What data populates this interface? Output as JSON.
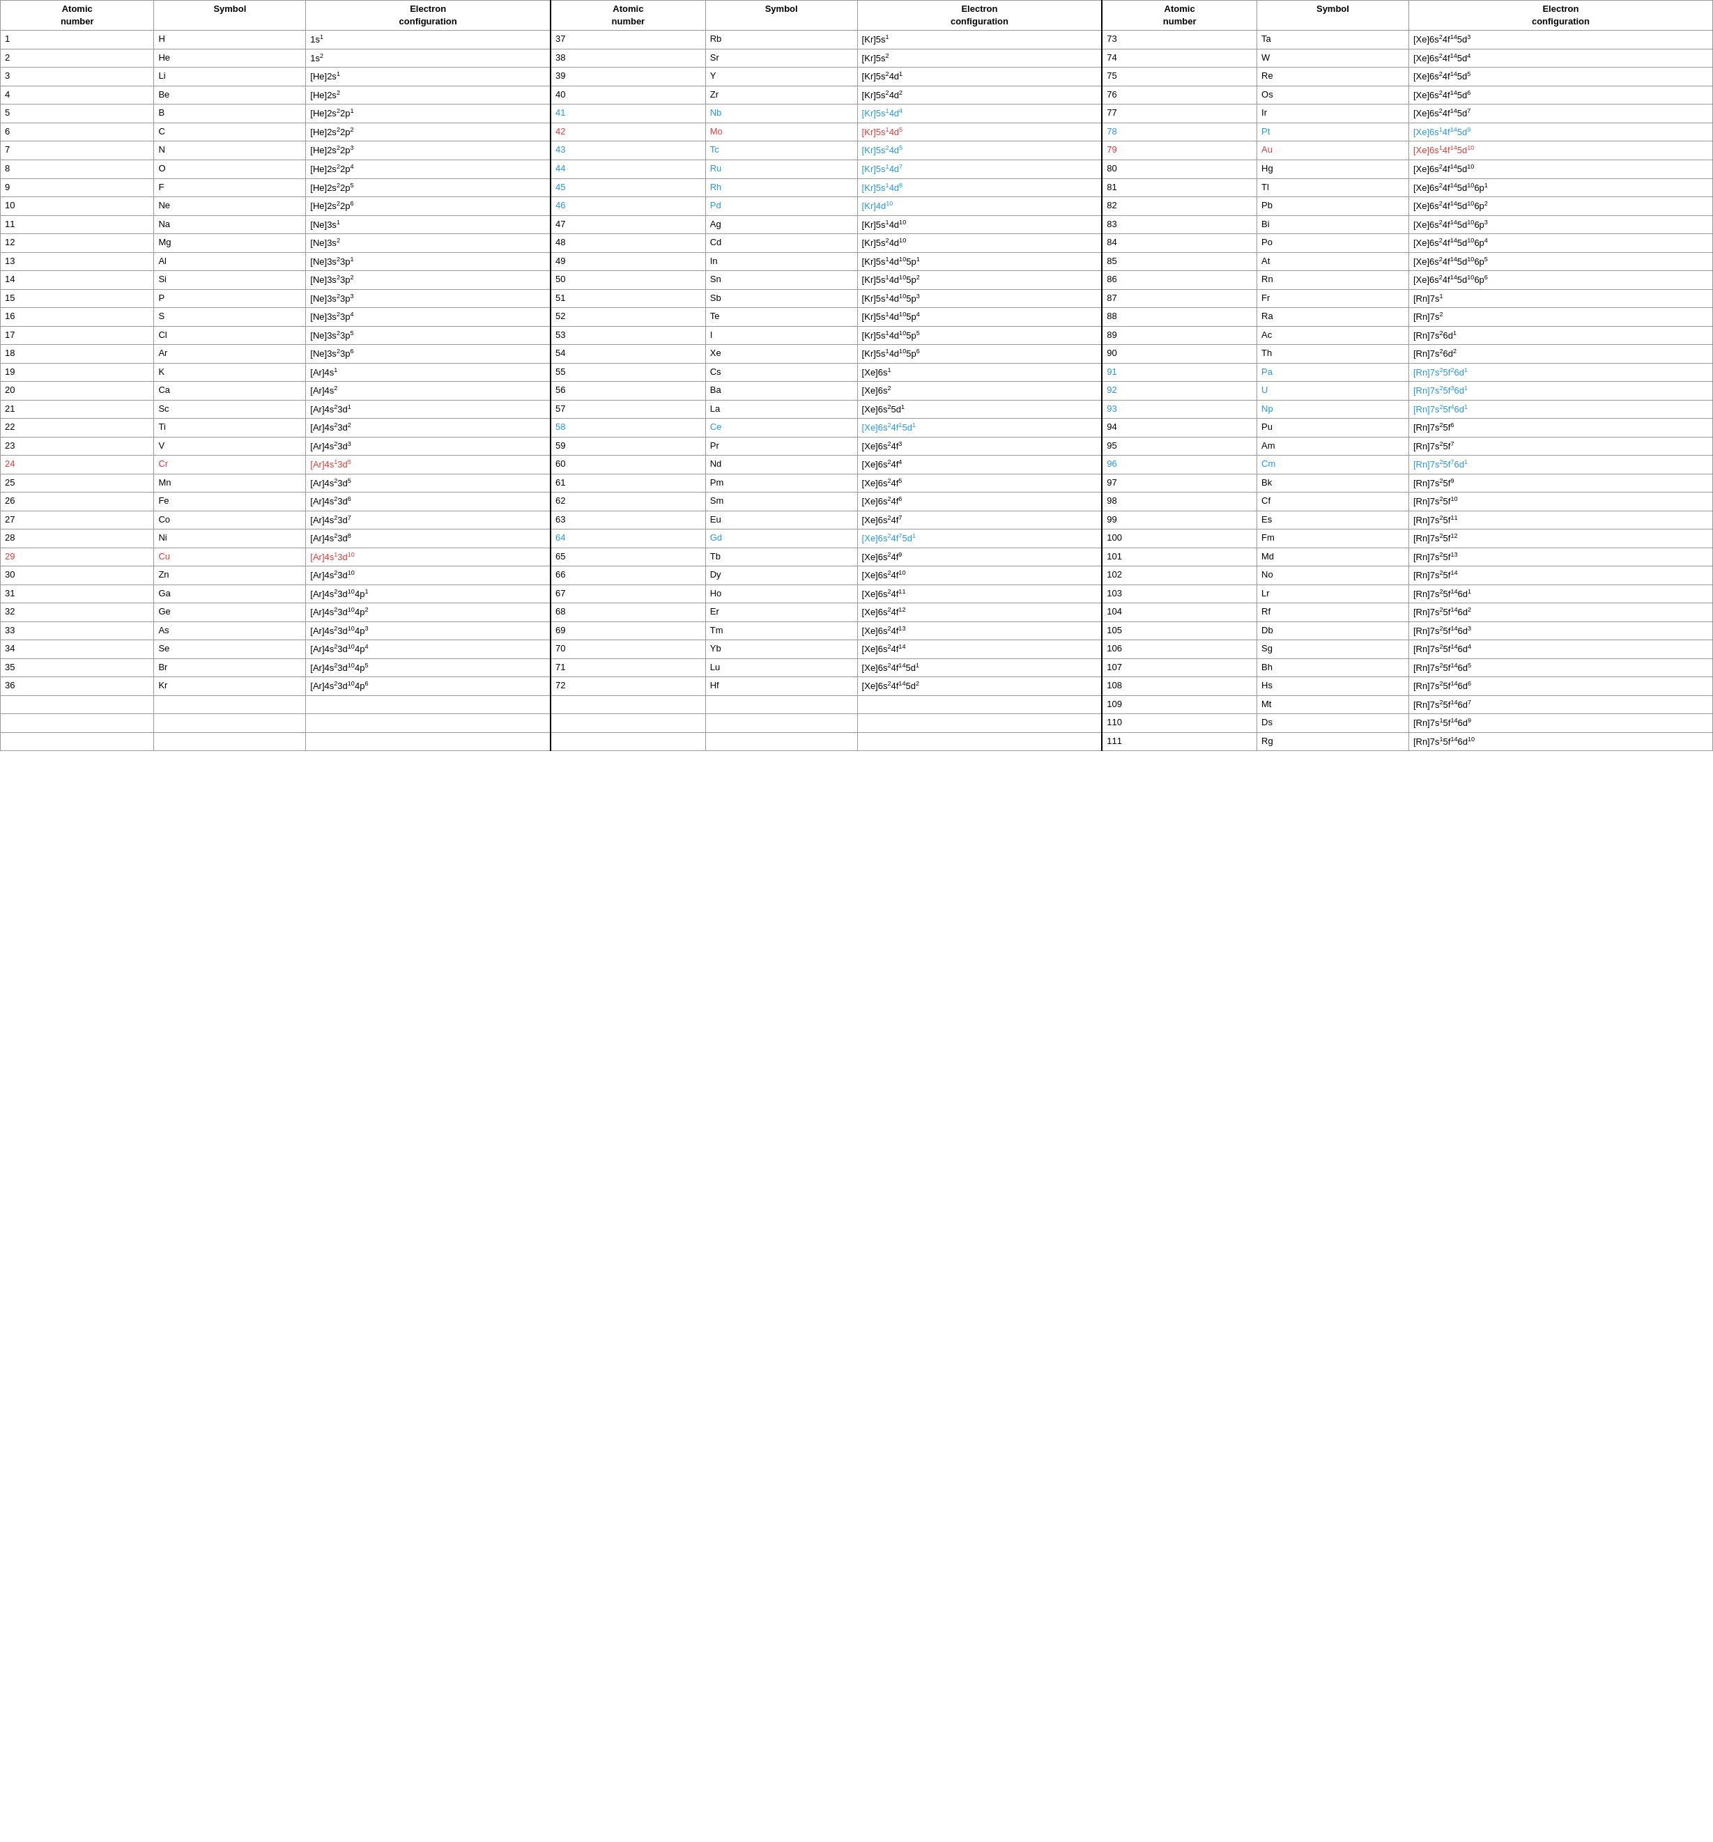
{
  "headers": {
    "atomic_number": "Atomic number",
    "symbol": "Symbol",
    "electron_config": "Electron configuration"
  },
  "elements": [
    {
      "num": "1",
      "sym": "H",
      "config": "1s<sup>1</sup>",
      "color": ""
    },
    {
      "num": "2",
      "sym": "He",
      "config": "1s<sup>2</sup>",
      "color": ""
    },
    {
      "num": "3",
      "sym": "Li",
      "config": "[He]2s<sup>1</sup>",
      "color": ""
    },
    {
      "num": "4",
      "sym": "Be",
      "config": "[He]2s<sup>2</sup>",
      "color": ""
    },
    {
      "num": "5",
      "sym": "B",
      "config": "[He]2s<sup>2</sup>2p<sup>1</sup>",
      "color": ""
    },
    {
      "num": "6",
      "sym": "C",
      "config": "[He]2s<sup>2</sup>2p<sup>2</sup>",
      "color": ""
    },
    {
      "num": "7",
      "sym": "N",
      "config": "[He]2s<sup>2</sup>2p<sup>3</sup>",
      "color": ""
    },
    {
      "num": "8",
      "sym": "O",
      "config": "[He]2s<sup>2</sup>2p<sup>4</sup>",
      "color": ""
    },
    {
      "num": "9",
      "sym": "F",
      "config": "[He]2s<sup>2</sup>2p<sup>5</sup>",
      "color": ""
    },
    {
      "num": "10",
      "sym": "Ne",
      "config": "[He]2s<sup>2</sup>2p<sup>6</sup>",
      "color": ""
    },
    {
      "num": "11",
      "sym": "Na",
      "config": "[Ne]3s<sup>1</sup>",
      "color": ""
    },
    {
      "num": "12",
      "sym": "Mg",
      "config": "[Ne]3s<sup>2</sup>",
      "color": ""
    },
    {
      "num": "13",
      "sym": "Al",
      "config": "[Ne]3s<sup>2</sup>3p<sup>1</sup>",
      "color": ""
    },
    {
      "num": "14",
      "sym": "Si",
      "config": "[Ne]3s<sup>2</sup>3p<sup>2</sup>",
      "color": ""
    },
    {
      "num": "15",
      "sym": "P",
      "config": "[Ne]3s<sup>2</sup>3p<sup>3</sup>",
      "color": ""
    },
    {
      "num": "16",
      "sym": "S",
      "config": "[Ne]3s<sup>2</sup>3p<sup>4</sup>",
      "color": ""
    },
    {
      "num": "17",
      "sym": "Cl",
      "config": "[Ne]3s<sup>2</sup>3p<sup>5</sup>",
      "color": ""
    },
    {
      "num": "18",
      "sym": "Ar",
      "config": "[Ne]3s<sup>2</sup>3p<sup>6</sup>",
      "color": ""
    },
    {
      "num": "19",
      "sym": "K",
      "config": "[Ar]4s<sup>1</sup>",
      "color": ""
    },
    {
      "num": "20",
      "sym": "Ca",
      "config": "[Ar]4s<sup>2</sup>",
      "color": ""
    },
    {
      "num": "21",
      "sym": "Sc",
      "config": "[Ar]4s<sup>2</sup>3d<sup>1</sup>",
      "color": ""
    },
    {
      "num": "22",
      "sym": "Ti",
      "config": "[Ar]4s<sup>2</sup>3d<sup>2</sup>",
      "color": ""
    },
    {
      "num": "23",
      "sym": "V",
      "config": "[Ar]4s<sup>2</sup>3d<sup>3</sup>",
      "color": ""
    },
    {
      "num": "24",
      "sym": "Cr",
      "config": "[Ar]4s<sup>1</sup>3d<sup>5</sup>",
      "color": "red"
    },
    {
      "num": "25",
      "sym": "Mn",
      "config": "[Ar]4s<sup>2</sup>3d<sup>5</sup>",
      "color": ""
    },
    {
      "num": "26",
      "sym": "Fe",
      "config": "[Ar]4s<sup>2</sup>3d<sup>6</sup>",
      "color": ""
    },
    {
      "num": "27",
      "sym": "Co",
      "config": "[Ar]4s<sup>2</sup>3d<sup>7</sup>",
      "color": ""
    },
    {
      "num": "28",
      "sym": "Ni",
      "config": "[Ar]4s<sup>2</sup>3d<sup>8</sup>",
      "color": ""
    },
    {
      "num": "29",
      "sym": "Cu",
      "config": "[Ar]4s<sup>1</sup>3d<sup>10</sup>",
      "color": "red"
    },
    {
      "num": "30",
      "sym": "Zn",
      "config": "[Ar]4s<sup>2</sup>3d<sup>10</sup>",
      "color": ""
    },
    {
      "num": "31",
      "sym": "Ga",
      "config": "[Ar]4s<sup>2</sup>3d<sup>10</sup>4p<sup>1</sup>",
      "color": ""
    },
    {
      "num": "32",
      "sym": "Ge",
      "config": "[Ar]4s<sup>2</sup>3d<sup>10</sup>4p<sup>2</sup>",
      "color": ""
    },
    {
      "num": "33",
      "sym": "As",
      "config": "[Ar]4s<sup>2</sup>3d<sup>10</sup>4p<sup>3</sup>",
      "color": ""
    },
    {
      "num": "34",
      "sym": "Se",
      "config": "[Ar]4s<sup>2</sup>3d<sup>10</sup>4p<sup>4</sup>",
      "color": ""
    },
    {
      "num": "35",
      "sym": "Br",
      "config": "[Ar]4s<sup>2</sup>3d<sup>10</sup>4p<sup>5</sup>",
      "color": ""
    },
    {
      "num": "36",
      "sym": "Kr",
      "config": "[Ar]4s<sup>2</sup>3d<sup>10</sup>4p<sup>6</sup>",
      "color": ""
    }
  ],
  "elements2": [
    {
      "num": "37",
      "sym": "Rb",
      "config": "[Kr]5s<sup>1</sup>",
      "color": ""
    },
    {
      "num": "38",
      "sym": "Sr",
      "config": "[Kr]5s<sup>2</sup>",
      "color": ""
    },
    {
      "num": "39",
      "sym": "Y",
      "config": "[Kr]5s<sup>2</sup>4d<sup>1</sup>",
      "color": ""
    },
    {
      "num": "40",
      "sym": "Zr",
      "config": "[Kr]5s<sup>2</sup>4d<sup>2</sup>",
      "color": ""
    },
    {
      "num": "41",
      "sym": "Nb",
      "config": "[Kr]5s<sup>1</sup>4d<sup>4</sup>",
      "color": "blue"
    },
    {
      "num": "42",
      "sym": "Mo",
      "config": "[Kr]5s<sup>1</sup>4d<sup>5</sup>",
      "color": "red"
    },
    {
      "num": "43",
      "sym": "Tc",
      "config": "[Kr]5s<sup>2</sup>4d<sup>5</sup>",
      "color": "blue"
    },
    {
      "num": "44",
      "sym": "Ru",
      "config": "[Kr]5s<sup>1</sup>4d<sup>7</sup>",
      "color": "blue"
    },
    {
      "num": "45",
      "sym": "Rh",
      "config": "[Kr]5s<sup>1</sup>4d<sup>8</sup>",
      "color": "blue"
    },
    {
      "num": "46",
      "sym": "Pd",
      "config": "[Kr]4d<sup>10</sup>",
      "color": "blue"
    },
    {
      "num": "47",
      "sym": "Ag",
      "config": "[Kr]5s<sup>1</sup>4d<sup>10</sup>",
      "color": ""
    },
    {
      "num": "48",
      "sym": "Cd",
      "config": "[Kr]5s<sup>2</sup>4d<sup>10</sup>",
      "color": ""
    },
    {
      "num": "49",
      "sym": "In",
      "config": "[Kr]5s<sup>1</sup>4d<sup>10</sup>5p<sup>1</sup>",
      "color": ""
    },
    {
      "num": "50",
      "sym": "Sn",
      "config": "[Kr]5s<sup>1</sup>4d<sup>10</sup>5p<sup>2</sup>",
      "color": ""
    },
    {
      "num": "51",
      "sym": "Sb",
      "config": "[Kr]5s<sup>1</sup>4d<sup>10</sup>5p<sup>3</sup>",
      "color": ""
    },
    {
      "num": "52",
      "sym": "Te",
      "config": "[Kr]5s<sup>1</sup>4d<sup>10</sup>5p<sup>4</sup>",
      "color": ""
    },
    {
      "num": "53",
      "sym": "I",
      "config": "[Kr]5s<sup>1</sup>4d<sup>10</sup>5p<sup>5</sup>",
      "color": ""
    },
    {
      "num": "54",
      "sym": "Xe",
      "config": "[Kr]5s<sup>1</sup>4d<sup>10</sup>5p<sup>6</sup>",
      "color": ""
    },
    {
      "num": "55",
      "sym": "Cs",
      "config": "[Xe]6s<sup>1</sup>",
      "color": ""
    },
    {
      "num": "56",
      "sym": "Ba",
      "config": "[Xe]6s<sup>2</sup>",
      "color": ""
    },
    {
      "num": "57",
      "sym": "La",
      "config": "[Xe]6s<sup>2</sup>5d<sup>1</sup>",
      "color": ""
    },
    {
      "num": "58",
      "sym": "Ce",
      "config": "[Xe]6s<sup>2</sup>4f<sup>1</sup>5d<sup>1</sup>",
      "color": "blue"
    },
    {
      "num": "59",
      "sym": "Pr",
      "config": "[Xe]6s<sup>2</sup>4f<sup>3</sup>",
      "color": ""
    },
    {
      "num": "60",
      "sym": "Nd",
      "config": "[Xe]6s<sup>2</sup>4f<sup>4</sup>",
      "color": ""
    },
    {
      "num": "61",
      "sym": "Pm",
      "config": "[Xe]6s<sup>2</sup>4f<sup>5</sup>",
      "color": ""
    },
    {
      "num": "62",
      "sym": "Sm",
      "config": "[Xe]6s<sup>2</sup>4f<sup>6</sup>",
      "color": ""
    },
    {
      "num": "63",
      "sym": "Eu",
      "config": "[Xe]6s<sup>2</sup>4f<sup>7</sup>",
      "color": ""
    },
    {
      "num": "64",
      "sym": "Gd",
      "config": "[Xe]6s<sup>2</sup>4f<sup>7</sup>5d<sup>1</sup>",
      "color": "blue"
    },
    {
      "num": "65",
      "sym": "Tb",
      "config": "[Xe]6s<sup>2</sup>4f<sup>9</sup>",
      "color": ""
    },
    {
      "num": "66",
      "sym": "Dy",
      "config": "[Xe]6s<sup>2</sup>4f<sup>10</sup>",
      "color": ""
    },
    {
      "num": "67",
      "sym": "Ho",
      "config": "[Xe]6s<sup>2</sup>4f<sup>11</sup>",
      "color": ""
    },
    {
      "num": "68",
      "sym": "Er",
      "config": "[Xe]6s<sup>2</sup>4f<sup>12</sup>",
      "color": ""
    },
    {
      "num": "69",
      "sym": "Tm",
      "config": "[Xe]6s<sup>2</sup>4f<sup>13</sup>",
      "color": ""
    },
    {
      "num": "70",
      "sym": "Yb",
      "config": "[Xe]6s<sup>2</sup>4f<sup>14</sup>",
      "color": ""
    },
    {
      "num": "71",
      "sym": "Lu",
      "config": "[Xe]6s<sup>2</sup>4f<sup>14</sup>5d<sup>1</sup>",
      "color": ""
    },
    {
      "num": "72",
      "sym": "Hf",
      "config": "[Xe]6s<sup>2</sup>4f<sup>14</sup>5d<sup>2</sup>",
      "color": ""
    }
  ],
  "elements3": [
    {
      "num": "73",
      "sym": "Ta",
      "config": "[Xe]6s<sup>2</sup>4f<sup>14</sup>5d<sup>3</sup>",
      "color": ""
    },
    {
      "num": "74",
      "sym": "W",
      "config": "[Xe]6s<sup>2</sup>4f<sup>14</sup>5d<sup>4</sup>",
      "color": ""
    },
    {
      "num": "75",
      "sym": "Re",
      "config": "[Xe]6s<sup>2</sup>4f<sup>14</sup>5d<sup>5</sup>",
      "color": ""
    },
    {
      "num": "76",
      "sym": "Os",
      "config": "[Xe]6s<sup>2</sup>4f<sup>14</sup>5d<sup>6</sup>",
      "color": ""
    },
    {
      "num": "77",
      "sym": "Ir",
      "config": "[Xe]6s<sup>2</sup>4f<sup>14</sup>5d<sup>7</sup>",
      "color": ""
    },
    {
      "num": "78",
      "sym": "Pt",
      "config": "[Xe]6s<sup>1</sup>4f<sup>14</sup>5d<sup>9</sup>",
      "color": "blue"
    },
    {
      "num": "79",
      "sym": "Au",
      "config": "[Xe]6s<sup>1</sup>4f<sup>14</sup>5d<sup>10</sup>",
      "color": "red"
    },
    {
      "num": "80",
      "sym": "Hg",
      "config": "[Xe]6s<sup>2</sup>4f<sup>14</sup>5d<sup>10</sup>",
      "color": ""
    },
    {
      "num": "81",
      "sym": "Tl",
      "config": "[Xe]6s<sup>2</sup>4f<sup>14</sup>5d<sup>10</sup>6p<sup>1</sup>",
      "color": ""
    },
    {
      "num": "82",
      "sym": "Pb",
      "config": "[Xe]6s<sup>2</sup>4f<sup>14</sup>5d<sup>10</sup>6p<sup>2</sup>",
      "color": ""
    },
    {
      "num": "83",
      "sym": "Bi",
      "config": "[Xe]6s<sup>2</sup>4f<sup>14</sup>5d<sup>10</sup>6p<sup>3</sup>",
      "color": ""
    },
    {
      "num": "84",
      "sym": "Po",
      "config": "[Xe]6s<sup>2</sup>4f<sup>14</sup>5d<sup>10</sup>6p<sup>4</sup>",
      "color": ""
    },
    {
      "num": "85",
      "sym": "At",
      "config": "[Xe]6s<sup>2</sup>4f<sup>14</sup>5d<sup>10</sup>6p<sup>5</sup>",
      "color": ""
    },
    {
      "num": "86",
      "sym": "Rn",
      "config": "[Xe]6s<sup>2</sup>4f<sup>14</sup>5d<sup>10</sup>6p<sup>6</sup>",
      "color": ""
    },
    {
      "num": "87",
      "sym": "Fr",
      "config": "[Rn]7s<sup>1</sup>",
      "color": ""
    },
    {
      "num": "88",
      "sym": "Ra",
      "config": "[Rn]7s<sup>2</sup>",
      "color": ""
    },
    {
      "num": "89",
      "sym": "Ac",
      "config": "[Rn]7s<sup>2</sup>6d<sup>1</sup>",
      "color": ""
    },
    {
      "num": "90",
      "sym": "Th",
      "config": "[Rn]7s<sup>2</sup>6d<sup>2</sup>",
      "color": ""
    },
    {
      "num": "91",
      "sym": "Pa",
      "config": "[Rn]7s<sup>2</sup>5f<sup>2</sup>6d<sup>1</sup>",
      "color": "blue"
    },
    {
      "num": "92",
      "sym": "U",
      "config": "[Rn]7s<sup>2</sup>5f<sup>3</sup>6d<sup>1</sup>",
      "color": "blue"
    },
    {
      "num": "93",
      "sym": "Np",
      "config": "[Rn]7s<sup>2</sup>5f<sup>4</sup>6d<sup>1</sup>",
      "color": "blue"
    },
    {
      "num": "94",
      "sym": "Pu",
      "config": "[Rn]7s<sup>2</sup>5f<sup>6</sup>",
      "color": ""
    },
    {
      "num": "95",
      "sym": "Am",
      "config": "[Rn]7s<sup>2</sup>5f<sup>7</sup>",
      "color": ""
    },
    {
      "num": "96",
      "sym": "Cm",
      "config": "[Rn]7s<sup>2</sup>5f<sup>7</sup>6d<sup>1</sup>",
      "color": "blue"
    },
    {
      "num": "97",
      "sym": "Bk",
      "config": "[Rn]7s<sup>2</sup>5f<sup>9</sup>",
      "color": ""
    },
    {
      "num": "98",
      "sym": "Cf",
      "config": "[Rn]7s<sup>2</sup>5f<sup>10</sup>",
      "color": ""
    },
    {
      "num": "99",
      "sym": "Es",
      "config": "[Rn]7s<sup>2</sup>5f<sup>11</sup>",
      "color": ""
    },
    {
      "num": "100",
      "sym": "Fm",
      "config": "[Rn]7s<sup>2</sup>5f<sup>12</sup>",
      "color": ""
    },
    {
      "num": "101",
      "sym": "Md",
      "config": "[Rn]7s<sup>2</sup>5f<sup>13</sup>",
      "color": ""
    },
    {
      "num": "102",
      "sym": "No",
      "config": "[Rn]7s<sup>2</sup>5f<sup>14</sup>",
      "color": ""
    },
    {
      "num": "103",
      "sym": "Lr",
      "config": "[Rn]7s<sup>2</sup>5f<sup>14</sup>6d<sup>1</sup>",
      "color": ""
    },
    {
      "num": "104",
      "sym": "Rf",
      "config": "[Rn]7s<sup>2</sup>5f<sup>14</sup>6d<sup>2</sup>",
      "color": ""
    },
    {
      "num": "105",
      "sym": "Db",
      "config": "[Rn]7s<sup>2</sup>5f<sup>14</sup>6d<sup>3</sup>",
      "color": ""
    },
    {
      "num": "106",
      "sym": "Sg",
      "config": "[Rn]7s<sup>2</sup>5f<sup>14</sup>6d<sup>4</sup>",
      "color": ""
    },
    {
      "num": "107",
      "sym": "Bh",
      "config": "[Rn]7s<sup>2</sup>5f<sup>14</sup>6d<sup>5</sup>",
      "color": ""
    },
    {
      "num": "108",
      "sym": "Hs",
      "config": "[Rn]7s<sup>2</sup>5f<sup>14</sup>6d<sup>6</sup>",
      "color": ""
    },
    {
      "num": "109",
      "sym": "Mt",
      "config": "[Rn]7s<sup>2</sup>5f<sup>14</sup>6d<sup>7</sup>",
      "color": ""
    },
    {
      "num": "110",
      "sym": "Ds",
      "config": "[Rn]7s<sup>1</sup>5f<sup>14</sup>6d<sup>9</sup>",
      "color": ""
    },
    {
      "num": "111",
      "sym": "Rg",
      "config": "[Rn]7s<sup>1</sup>5f<sup>14</sup>6d<sup>10</sup>",
      "color": ""
    }
  ]
}
